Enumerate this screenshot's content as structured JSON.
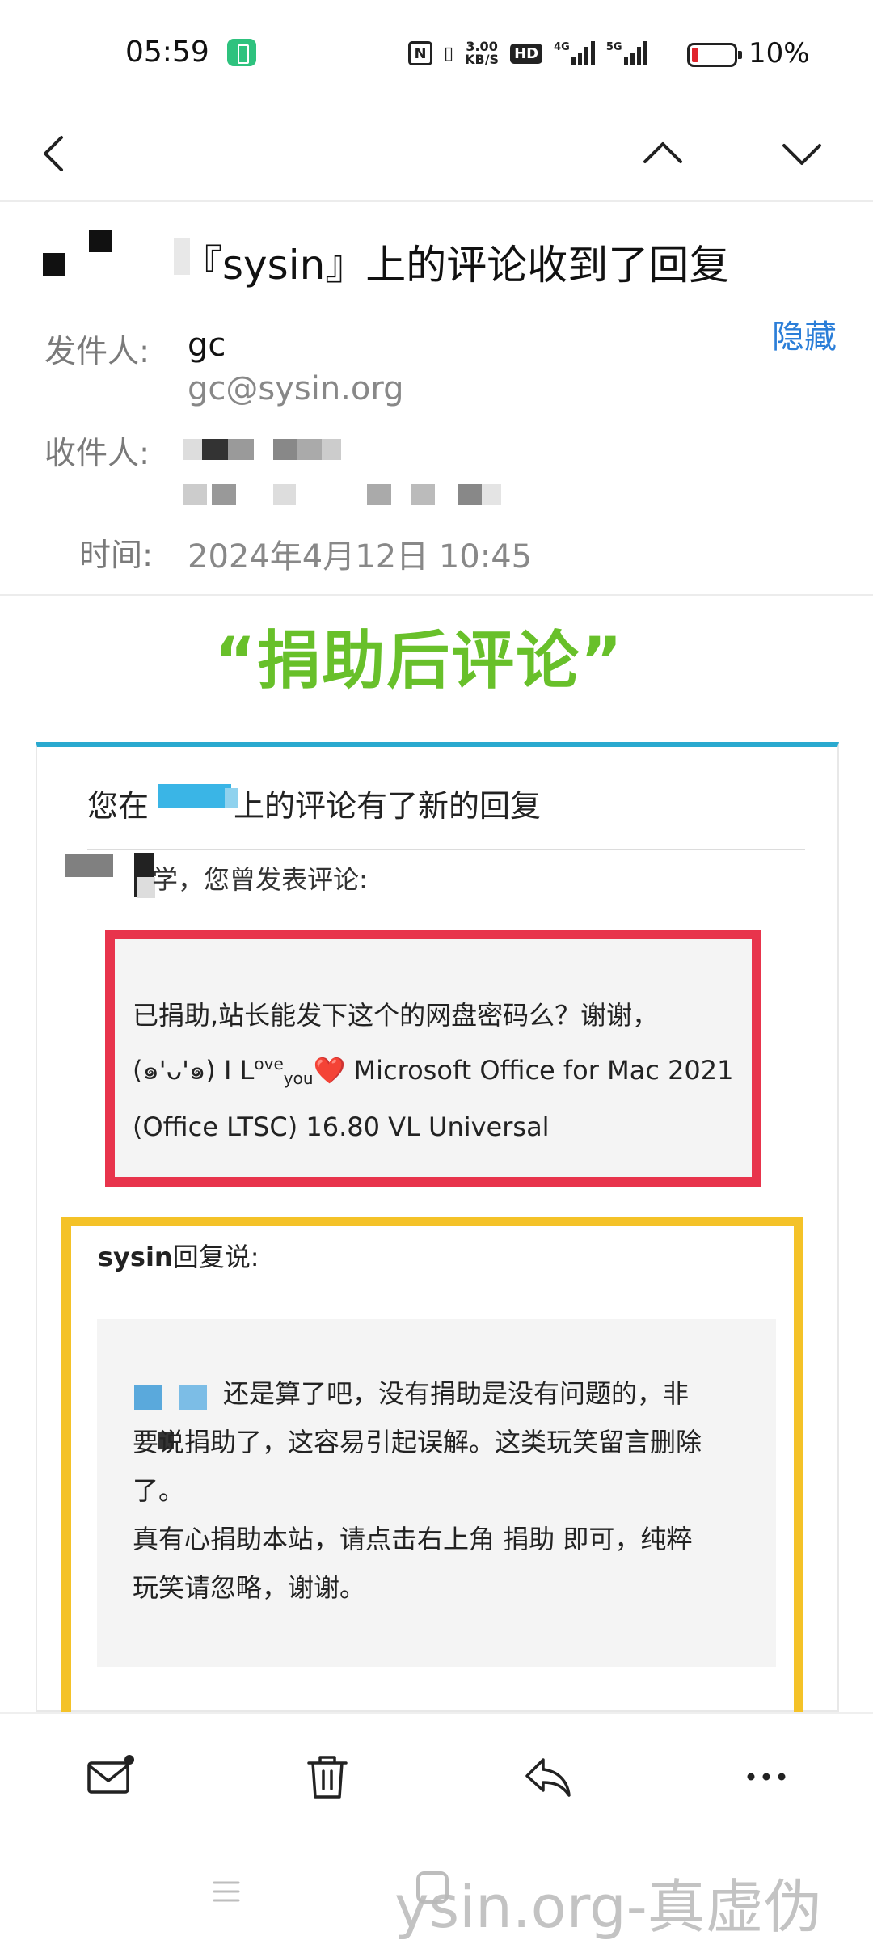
{
  "status_bar": {
    "time": "05:59",
    "net_speed_value": "3.00",
    "net_speed_unit": "KB/S",
    "hd_label": "HD",
    "signal1_label": "4G",
    "signal2_label": "5G",
    "battery_percent": "10%"
  },
  "nav": {
    "back_icon": "chevron-left",
    "prev_icon": "chevron-up",
    "next_icon": "chevron-down"
  },
  "email": {
    "subject": "『sysin』上的评论收到了回复",
    "sender_label": "发件人:",
    "sender_name": "gc",
    "sender_email": "gc@sysin.org",
    "hide_link": "隐藏",
    "recipient_label": "收件人:",
    "time_label": "时间:",
    "time_value": "2024年4月12日 10:45"
  },
  "annotation": "“捐助后评论”",
  "body": {
    "title_prefix": "您在",
    "title_suffix": "上的评论有了新的回复",
    "greeting": "学，您曾发表评论:",
    "comment": {
      "line1": "已捐助,站长能发下这个的网盘密码么？谢谢，",
      "line2_prefix": "(๑'ᴗ'๑) I L",
      "love_sup": "ove",
      "love_sub": "you",
      "heart": "❤️",
      "line2_suffix": " Microsoft Office for Mac 2021",
      "line3": "(Office LTSC) 16.80 VL Universal"
    },
    "reply": {
      "author": "sysin",
      "said": "回复说:",
      "line1": "还是算了吧，没有捐助是没有问题的，非",
      "line2": "要说捐助了，这容易引起误解。这类玩笑留言删除",
      "line3": "了。",
      "line4": "真有心捐助本站，请点击右上角 捐助 即可，纯粹",
      "line5": "玩笑请忽略，谢谢。"
    }
  },
  "toolbar": {
    "mark_icon": "mail-unread",
    "delete_icon": "trash",
    "reply_icon": "reply",
    "more_icon": "more"
  },
  "watermark": "ysin.org-真虚伪",
  "colors": {
    "link": "#2b7ed8",
    "accent_top": "#2aa9cf",
    "annotation": "#68c02a",
    "red_frame": "#e8344c",
    "yellow_frame": "#f4c228"
  }
}
